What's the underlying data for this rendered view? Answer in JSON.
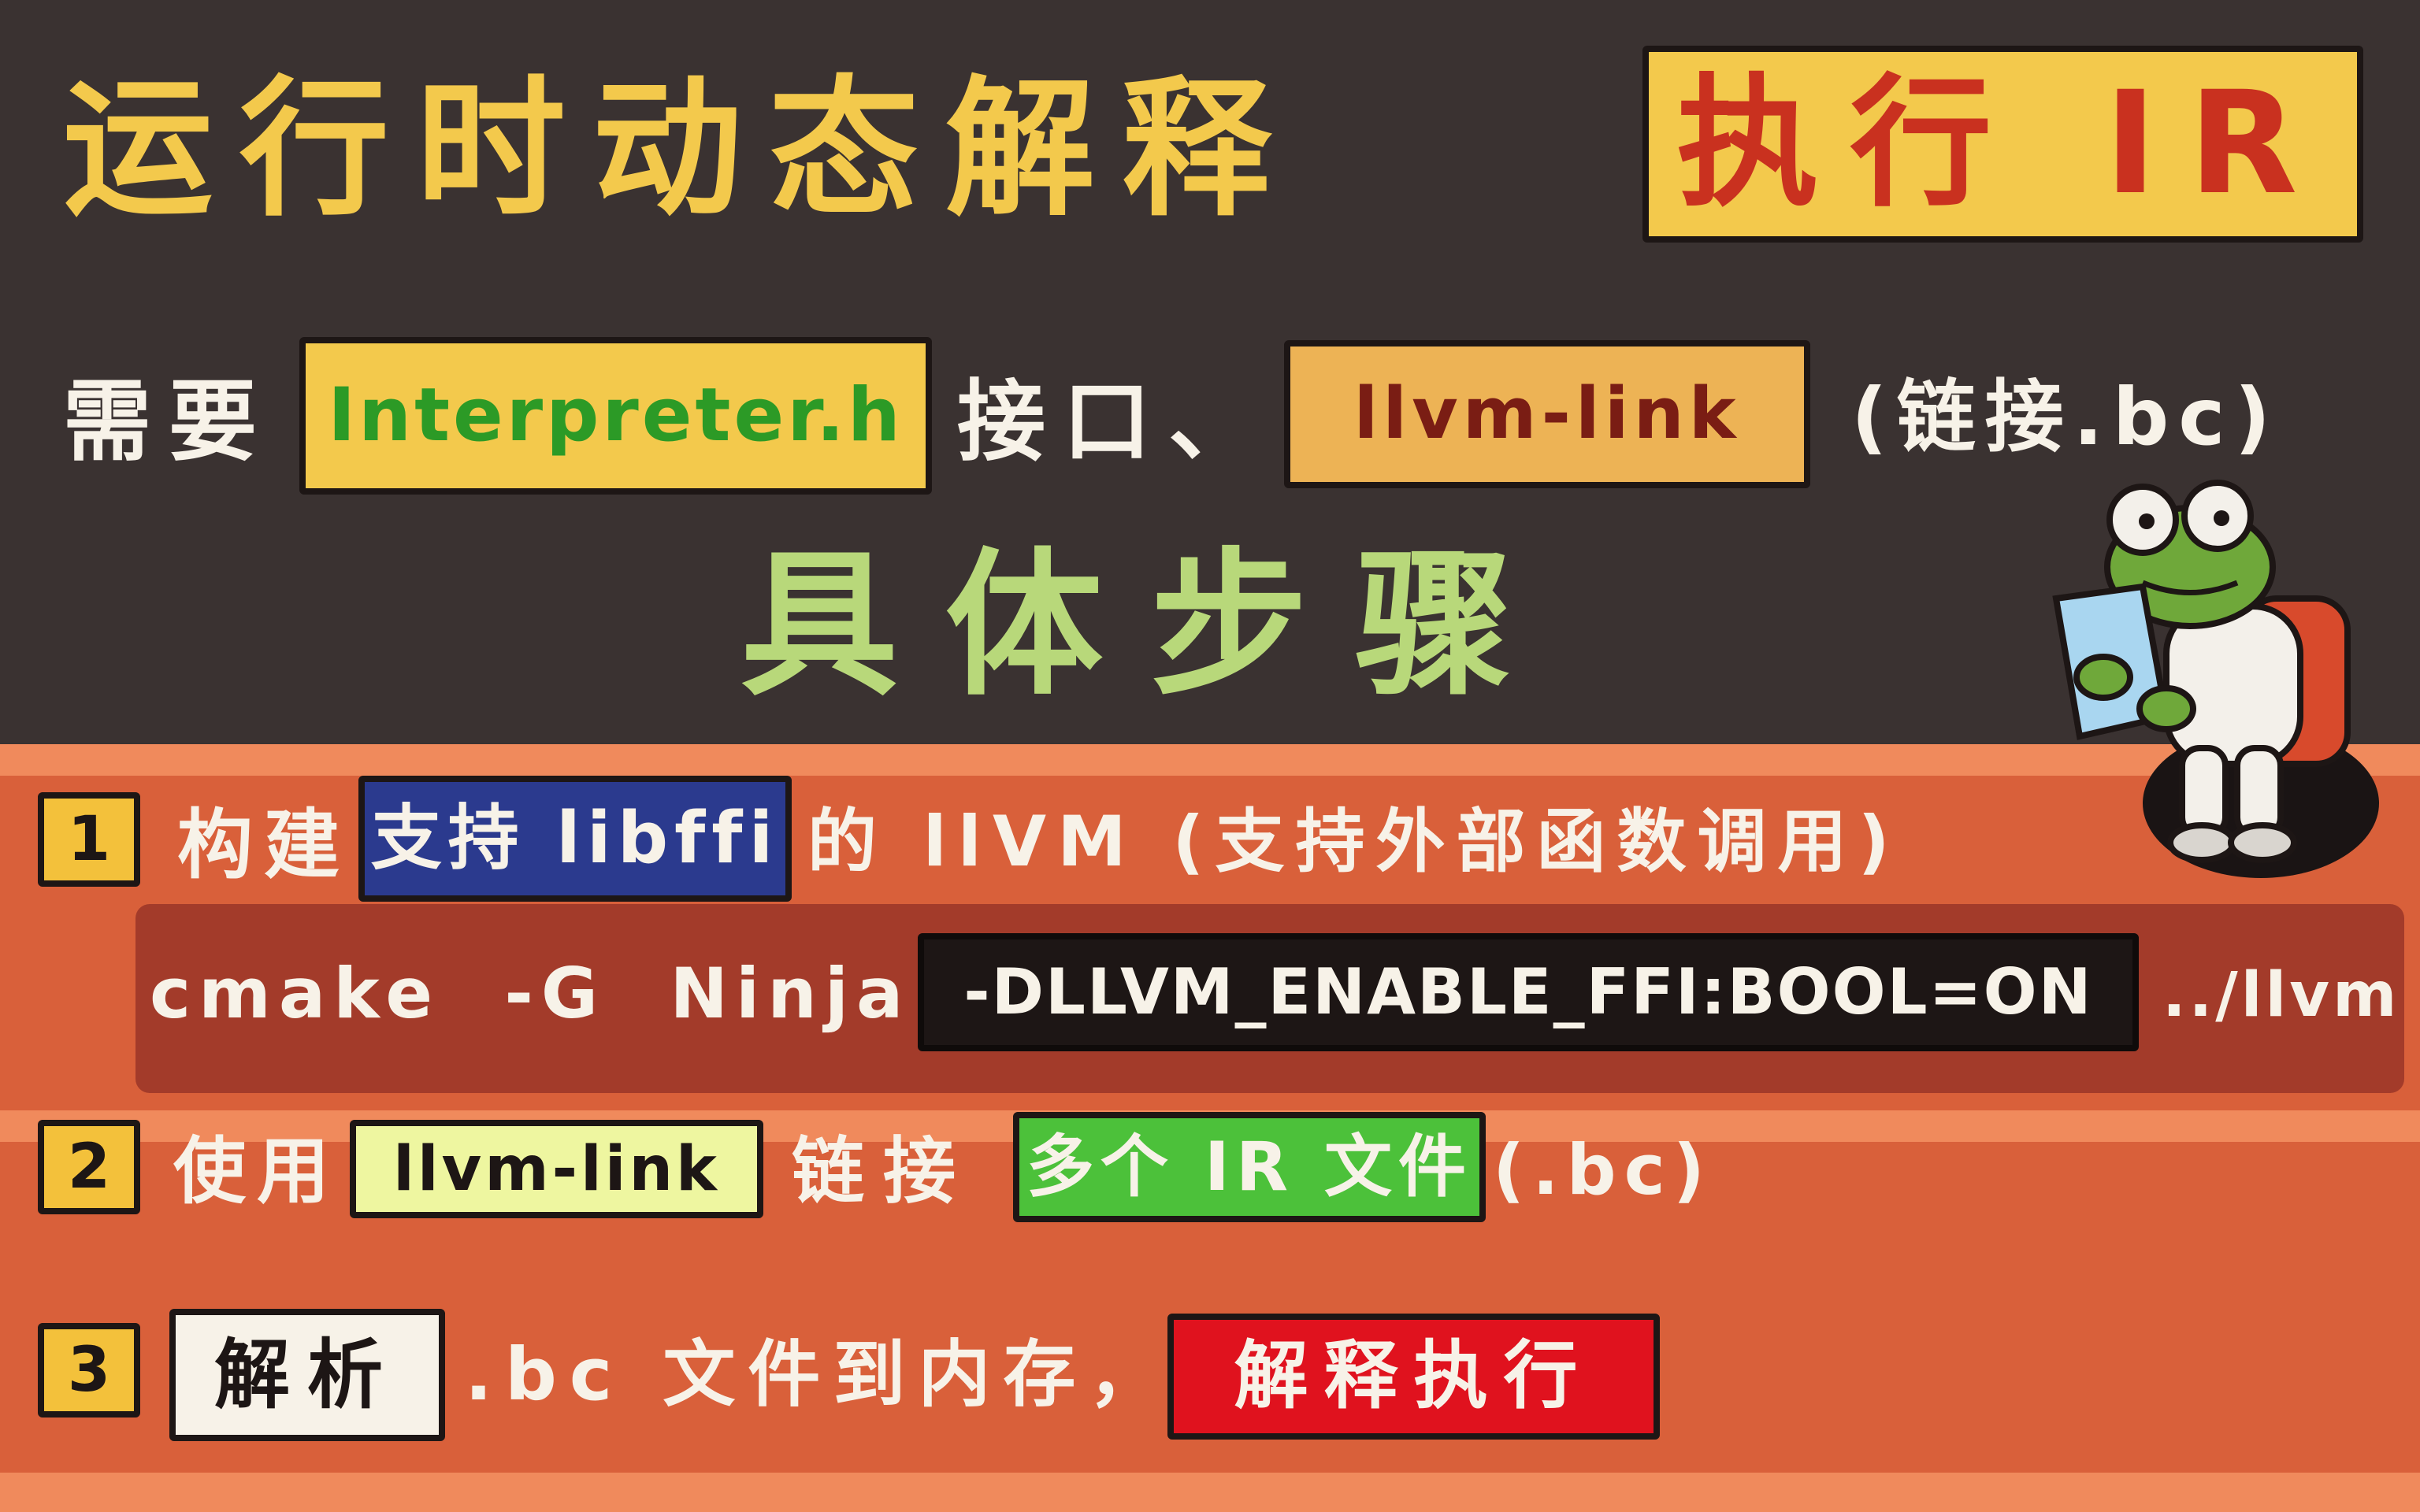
{
  "title": {
    "main": "运行时动态解释",
    "highlight": "执行 IR"
  },
  "subtitle": {
    "prefix": "需要",
    "interp_box": "Interpreter.h",
    "mid": "接口、",
    "link_box": "llvm-link",
    "suffix": "(链接.bc)"
  },
  "steps_heading": "具体步骤",
  "steps": [
    {
      "num": "1",
      "pre": "构建",
      "box": "支持 libffi",
      "post": "的 llVM (支持外部函数调用)"
    },
    {
      "num": "2",
      "pre": "使用",
      "box1": "llvm-link",
      "mid": "链接",
      "box2": "多个 IR 文件",
      "post": "(.bc)"
    },
    {
      "num": "3",
      "box1": "解析",
      "mid": ".bc 文件到内存，",
      "box2": "解释执行"
    }
  ],
  "code": {
    "prefix": "cmake  -G  Ninja",
    "flag": "-DLLVM_ENABLE_FFI:BOOL=ON",
    "suffix": "../llvm"
  },
  "colors": {
    "dark_bg": "#3a3231",
    "orange_bg": "#d9603a",
    "title_yellow": "#f3c94c",
    "heading_green": "#b8d87a",
    "box_blue": "#2b3a8e",
    "box_green": "#4cc13a",
    "box_red": "#e0121e",
    "box_lime": "#eef6a0",
    "code_bar": "#a33b2a"
  },
  "icons": {
    "mascot": "frog-reading-map-icon"
  }
}
